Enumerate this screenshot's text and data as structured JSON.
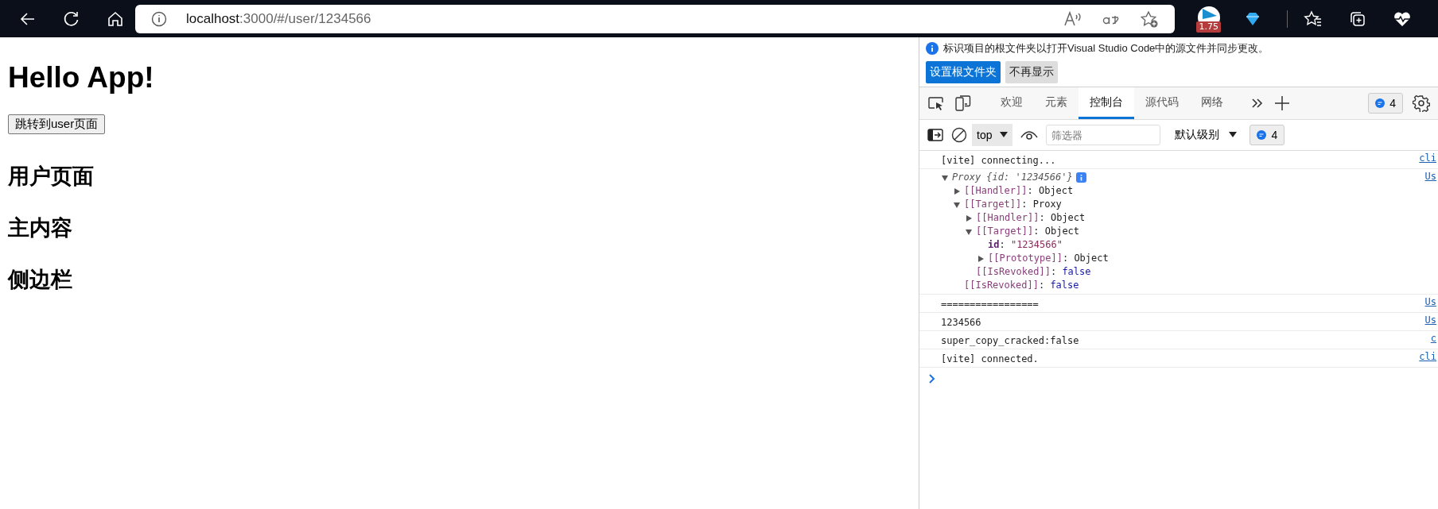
{
  "browser": {
    "address": {
      "host": "localhost",
      "path": ":3000/#/user/1234566"
    },
    "extension_badge": "1.75"
  },
  "page": {
    "title": "Hello App!",
    "button": "跳转到user页面",
    "headings": [
      "用户页面",
      "主内容",
      "侧边栏"
    ]
  },
  "devtools": {
    "notice": {
      "text": "标识项目的根文件夹以打开Visual Studio Code中的源文件并同步更改。",
      "buttons": [
        {
          "label": "设置根文件夹",
          "kind": "primary"
        },
        {
          "label": "不再显示",
          "kind": "secondary"
        }
      ]
    },
    "tabs": [
      {
        "label": "欢迎",
        "selected": false
      },
      {
        "label": "元素",
        "selected": false
      },
      {
        "label": "控制台",
        "selected": true
      },
      {
        "label": "源代码",
        "selected": false
      },
      {
        "label": "网络",
        "selected": false
      }
    ],
    "issues_count": "4",
    "toolbar": {
      "context": "top",
      "filter_placeholder": "筛选器",
      "level": "默认级别",
      "count": "4"
    },
    "messages": [
      {
        "kind": "text",
        "text": "[vite] connecting...",
        "source": "cli"
      },
      {
        "kind": "object",
        "summary": "Proxy {id: '1234566'}",
        "expanded": true,
        "source": "Us",
        "children": [
          {
            "kind": "group",
            "key": "[[Handler]]",
            "internal": true,
            "sep": ":",
            "value": {
              "kind": "object",
              "text": "Object"
            },
            "expanded": false
          },
          {
            "kind": "group",
            "key": "[[Target]]",
            "internal": true,
            "sep": ":",
            "value": {
              "kind": "object",
              "text": "Proxy"
            },
            "expanded": true,
            "children": [
              {
                "kind": "group",
                "key": "[[Handler]]",
                "internal": true,
                "sep": ":",
                "value": {
                  "kind": "object",
                  "text": "Object"
                },
                "expanded": false
              },
              {
                "kind": "group",
                "key": "[[Target]]",
                "internal": true,
                "sep": ":",
                "value": {
                  "kind": "object",
                  "text": "Object"
                },
                "expanded": true,
                "children": [
                  {
                    "kind": "leaf",
                    "key": "id",
                    "internal": false,
                    "sep": ":",
                    "value": {
                      "kind": "string",
                      "text": "\"1234566\""
                    }
                  },
                  {
                    "kind": "group",
                    "key": "[[Prototype]]",
                    "internal": true,
                    "sep": ":",
                    "value": {
                      "kind": "object",
                      "text": "Object"
                    },
                    "expanded": false
                  }
                ]
              },
              {
                "kind": "leaf",
                "key": "[[IsRevoked]]",
                "internal": true,
                "sep": ":",
                "value": {
                  "kind": "boolean",
                  "text": "false"
                }
              }
            ]
          },
          {
            "kind": "leaf",
            "key": "[[IsRevoked]]",
            "internal": true,
            "sep": ":",
            "value": {
              "kind": "boolean",
              "text": "false"
            }
          }
        ]
      },
      {
        "kind": "text",
        "text": "=================",
        "source": "Us"
      },
      {
        "kind": "text",
        "text": "1234566",
        "source": "Us"
      },
      {
        "kind": "text",
        "text": "super_copy_cracked:false",
        "source": "c"
      },
      {
        "kind": "text",
        "text": "[vite] connected.",
        "source": "cli"
      }
    ]
  }
}
